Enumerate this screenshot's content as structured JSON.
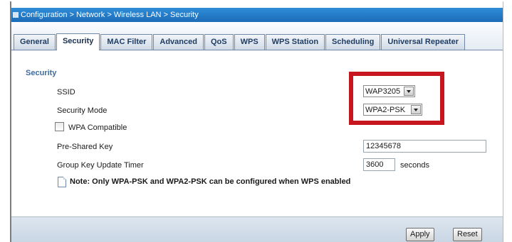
{
  "breadcrumb": "Configuration > Network > Wireless LAN > Security",
  "tabs": [
    {
      "label": "General",
      "active": false
    },
    {
      "label": "Security",
      "active": true
    },
    {
      "label": "MAC Filter",
      "active": false
    },
    {
      "label": "Advanced",
      "active": false
    },
    {
      "label": "QoS",
      "active": false
    },
    {
      "label": "WPS",
      "active": false
    },
    {
      "label": "WPS Station",
      "active": false
    },
    {
      "label": "Scheduling",
      "active": false
    },
    {
      "label": "Universal Repeater",
      "active": false
    }
  ],
  "section": {
    "heading": "Security"
  },
  "form": {
    "ssid_label": "SSID",
    "ssid_value": "WAP3205",
    "security_mode_label": "Security Mode",
    "security_mode_value": "WPA2-PSK",
    "wpa_compatible_label": "WPA Compatible",
    "wpa_compatible_checked": false,
    "psk_label": "Pre-Shared Key",
    "psk_value": "12345678",
    "timer_label": "Group Key Update Timer",
    "timer_value": "3600",
    "timer_unit": "seconds"
  },
  "note": "Note: Only WPA-PSK and WPA2-PSK can be configured when WPS enabled",
  "buttons": {
    "apply": "Apply",
    "reset": "Reset"
  },
  "colors": {
    "highlight": "#c7161d",
    "title_bar": "#1c6bb8",
    "heading": "#3d6c9e"
  }
}
